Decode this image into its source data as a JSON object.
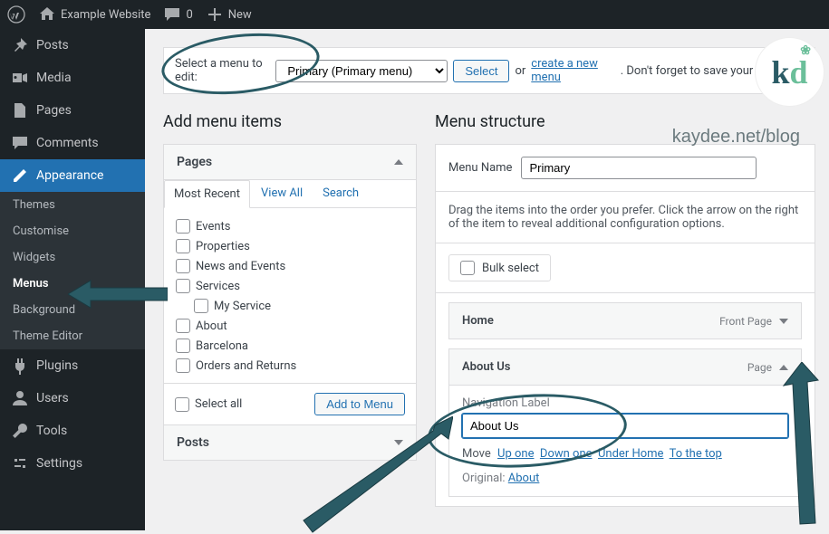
{
  "topbar": {
    "site_name": "Example Website",
    "comments_count": "0",
    "new_label": "New"
  },
  "sidebar": {
    "posts": "Posts",
    "media": "Media",
    "pages": "Pages",
    "comments": "Comments",
    "appearance": "Appearance",
    "appearance_sub": {
      "themes": "Themes",
      "customise": "Customise",
      "widgets": "Widgets",
      "menus": "Menus",
      "background": "Background",
      "theme_editor": "Theme Editor"
    },
    "plugins": "Plugins",
    "users": "Users",
    "tools": "Tools",
    "settings": "Settings"
  },
  "menu_bar": {
    "select_label": "Select a menu to edit:",
    "selected_menu": "Primary (Primary menu)",
    "select_btn": "Select",
    "or": "or",
    "create_link": "create a new menu",
    "tail": ". Don't forget to save your changes!"
  },
  "left_col": {
    "heading": "Add menu items",
    "pages_panel": "Pages",
    "tabs": {
      "recent": "Most Recent",
      "all": "View All",
      "search": "Search"
    },
    "page_items": [
      "Events",
      "Properties",
      "News and Events",
      "Services",
      "My Service",
      "About",
      "Barcelona",
      "Orders and Returns"
    ],
    "select_all": "Select all",
    "add_btn": "Add to Menu",
    "posts_panel": "Posts"
  },
  "right_col": {
    "heading": "Menu structure",
    "menu_name_label": "Menu Name",
    "menu_name_value": "Primary",
    "drag_instr": "Drag the items into the order you prefer. Click the arrow on the right of the item to reveal additional configuration options.",
    "bulk_select": "Bulk select",
    "items": {
      "home": {
        "title": "Home",
        "type": "Front Page"
      },
      "about": {
        "title": "About Us",
        "type": "Page",
        "nav_label_label": "Navigation Label",
        "nav_label_value": "About Us",
        "move_label": "Move",
        "move_up": "Up one",
        "move_down": "Down one",
        "move_under": "Under Home",
        "move_top": "To the top",
        "original_label": "Original:",
        "original_link": "About"
      }
    }
  },
  "watermark_text": "kaydee.net/blog"
}
